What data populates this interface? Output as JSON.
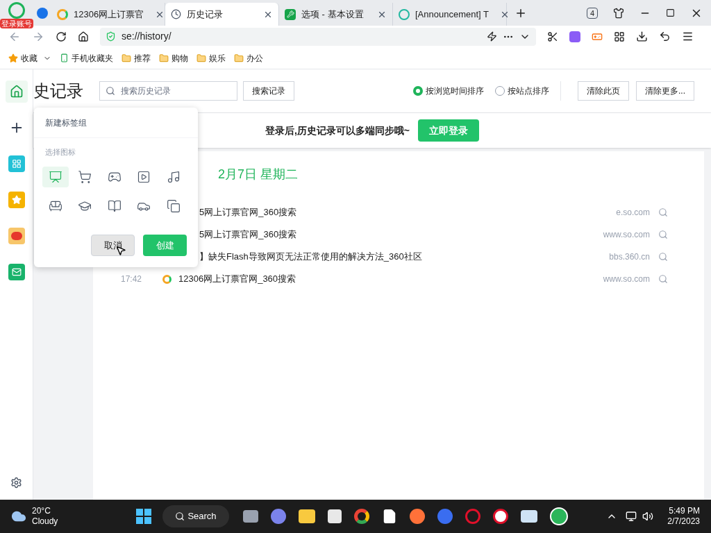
{
  "browser": {
    "account_badge": "登录账号",
    "tabs": [
      {
        "title": "12306网上订票官",
        "selected": false,
        "kind": "search"
      },
      {
        "title": "历史记录",
        "selected": true,
        "kind": "history"
      },
      {
        "title": "选项 - 基本设置",
        "selected": false,
        "kind": "settings"
      },
      {
        "title": "[Announcement] T",
        "selected": false,
        "kind": "forum"
      }
    ],
    "tab_count": "4",
    "address": "se://history/",
    "bookmarks": [
      {
        "label": "收藏",
        "kind": "favorites"
      },
      {
        "label": "手机收藏夹",
        "kind": "phone"
      },
      {
        "label": "推荐",
        "kind": "folder"
      },
      {
        "label": "购物",
        "kind": "folder"
      },
      {
        "label": "娱乐",
        "kind": "folder"
      },
      {
        "label": "办公",
        "kind": "folder"
      }
    ]
  },
  "sidebar": {
    "items": [
      {
        "kind": "home",
        "selected": true
      },
      {
        "kind": "add",
        "selected": false
      },
      {
        "kind": "apps",
        "selected": false
      },
      {
        "kind": "star",
        "selected": false
      },
      {
        "kind": "weibo",
        "selected": false
      },
      {
        "kind": "mail",
        "selected": false
      }
    ]
  },
  "history": {
    "title": "史记录",
    "search": {
      "placeholder": "搜索历史记录"
    },
    "search_button": "搜索记录",
    "sort_options": [
      {
        "label": "按浏览时间排序",
        "selected": true
      },
      {
        "label": "按站点排序",
        "selected": false
      }
    ],
    "clear_page": "清除此页",
    "clear_more": "清除更多...",
    "login_banner": {
      "text": "登录后,历史记录可以多端同步哦~",
      "button": "立即登录"
    },
    "date_heading": "2月7日 星期二",
    "rows": [
      {
        "time": "",
        "title": "5网上订票官网_360搜索",
        "site": "e.so.com"
      },
      {
        "time": "",
        "title": "5网上订票官网_360搜索",
        "site": "www.so.com"
      },
      {
        "time": "",
        "title": "】缺失Flash导致网页无法正常使用的解决方法_360社区",
        "site": "bbs.360.cn"
      },
      {
        "time": "17:42",
        "title": "12306网上订票官网_360搜索",
        "site": "www.so.com"
      }
    ]
  },
  "popup": {
    "name_placeholder": "新建标签组",
    "icons_label": "选择图标",
    "icons": [
      {
        "selected": true
      },
      {
        "selected": false
      },
      {
        "selected": false
      },
      {
        "selected": false
      },
      {
        "selected": false
      },
      {
        "selected": false
      },
      {
        "selected": false
      },
      {
        "selected": false
      },
      {
        "selected": false
      },
      {
        "selected": false
      }
    ],
    "cancel": "取消",
    "create": "创建"
  },
  "taskbar": {
    "temperature": "20°C",
    "weather": "Cloudy",
    "search": "Search",
    "time": "5:49 PM",
    "date": "2/7/2023"
  }
}
